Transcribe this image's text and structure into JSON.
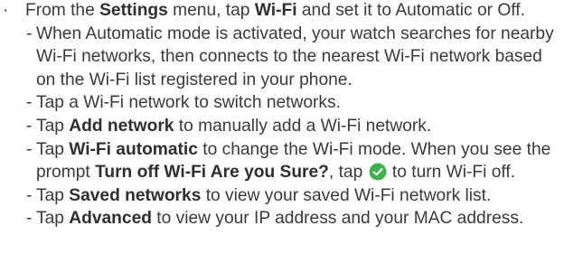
{
  "bullet_symbol": "·",
  "dash_symbol": "-",
  "intro": {
    "t1": "From the ",
    "b1": "Settings",
    "t2": " menu, tap ",
    "b2": "Wi-Fi",
    "t3": " and set it to Automatic or Off."
  },
  "item1": {
    "line1": "When Automatic mode is activated, your watch searches for nearby",
    "line2": "Wi-Fi networks, then connects to the nearest Wi-Fi network based",
    "line3": "on the Wi-Fi list registered in your phone."
  },
  "item2": {
    "text": "Tap a Wi-Fi network to switch networks."
  },
  "item3": {
    "t1": "Tap ",
    "b1": "Add network",
    "t2": " to manually add a Wi-Fi network."
  },
  "item4": {
    "t1": "Tap ",
    "b1": "Wi-Fi automatic",
    "t2": " to change the Wi-Fi mode. When you see the",
    "t3": "prompt ",
    "b2": "Turn off Wi-Fi Are you Sure?",
    "t4": ", tap ",
    "t5": " to turn Wi-Fi off.",
    "icon": "check-circle-icon",
    "icon_color": "#3ab54a"
  },
  "item5": {
    "t1": "Tap ",
    "b1": "Saved networks",
    "t2": " to view your saved Wi-Fi network list."
  },
  "item6": {
    "t1": "Tap ",
    "b1": "Advanced",
    "t2": " to view your IP address and your MAC address."
  }
}
